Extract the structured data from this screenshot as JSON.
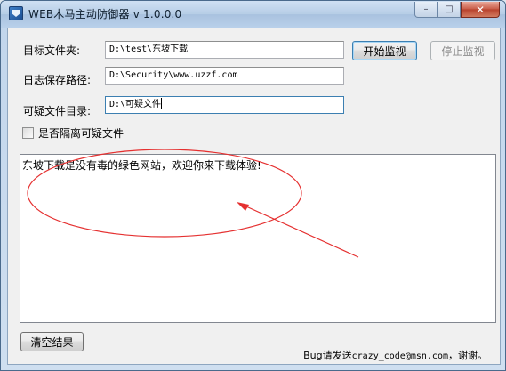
{
  "window": {
    "title": "WEB木马主动防御器 v 1.0.0.0",
    "controls": {
      "minimize": "–",
      "maximize": "□",
      "close": "✕"
    }
  },
  "form": {
    "target_dir": {
      "label": "目标文件夹:",
      "value": "D:\\test\\东坡下载"
    },
    "log_path": {
      "label": "日志保存路径:",
      "value": "D:\\Security\\www.uzzf.com"
    },
    "suspicious_dir": {
      "label": "可疑文件目录:",
      "value": "D:\\可疑文件"
    },
    "quarantine": {
      "label": "是否隔离可疑文件",
      "checked": false
    }
  },
  "buttons": {
    "start": "开始监视",
    "stop": "停止监视",
    "clear": "清空结果"
  },
  "result_text": "东坡下载是没有毒的绿色网站，欢迎你来下载体验!",
  "footer": {
    "prefix": "Bug请发送",
    "email": "crazy_code@msn.com",
    "suffix": "，谢谢。"
  },
  "colors": {
    "annotation": "#e53030",
    "accent": "#3c7fb1"
  }
}
